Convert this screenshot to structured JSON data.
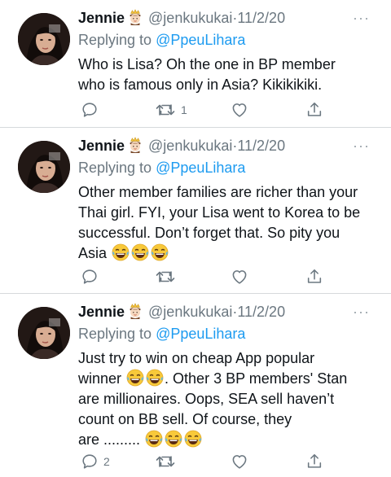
{
  "tweets": [
    {
      "name": "Jennie",
      "handle": "@jenkukukai",
      "dot": "·",
      "date": "11/2/20",
      "reply_prefix": "Replying to",
      "reply_to": "@PpeuLihara",
      "lines": [
        "Who is Lisa? Oh the one in BP member",
        "who is famous only in Asia? Kikikikiki."
      ],
      "reply_count": "",
      "retweet_count": "1",
      "like_count": ""
    },
    {
      "name": "Jennie",
      "handle": "@jenkukukai",
      "dot": "·",
      "date": "11/2/20",
      "reply_prefix": "Replying to",
      "reply_to": "@PpeuLihara",
      "lines": [
        "Other member families are richer than your",
        "Thai girl. FYI, your Lisa went to Korea to be",
        "successful. Don’t forget that. So pity you",
        "Asia"
      ],
      "reply_count": "",
      "retweet_count": "",
      "like_count": ""
    },
    {
      "name": "Jennie",
      "handle": "@jenkukukai",
      "dot": "·",
      "date": "11/2/20",
      "reply_prefix": "Replying to",
      "reply_to": "@PpeuLihara",
      "lines": [
        "Just try to win on cheap App popular",
        "winner",
        ". Other 3 BP members' Stan",
        "are millionaires.  Oops, SEA sell haven’t",
        "count on BB sell. Of course, they",
        "are ........."
      ],
      "reply_count": "2",
      "retweet_count": "",
      "like_count": ""
    }
  ],
  "more_label": "···",
  "icons": {
    "reply": "reply-icon",
    "retweet": "retweet-icon",
    "like": "like-icon",
    "share": "share-icon",
    "crown": "princess-emoji",
    "laugh": "tears-of-joy-emoji"
  },
  "colors": {
    "link": "#1d9bf0",
    "muted": "#6b7780",
    "text": "#0f1419",
    "divider": "#d6d9dc"
  }
}
